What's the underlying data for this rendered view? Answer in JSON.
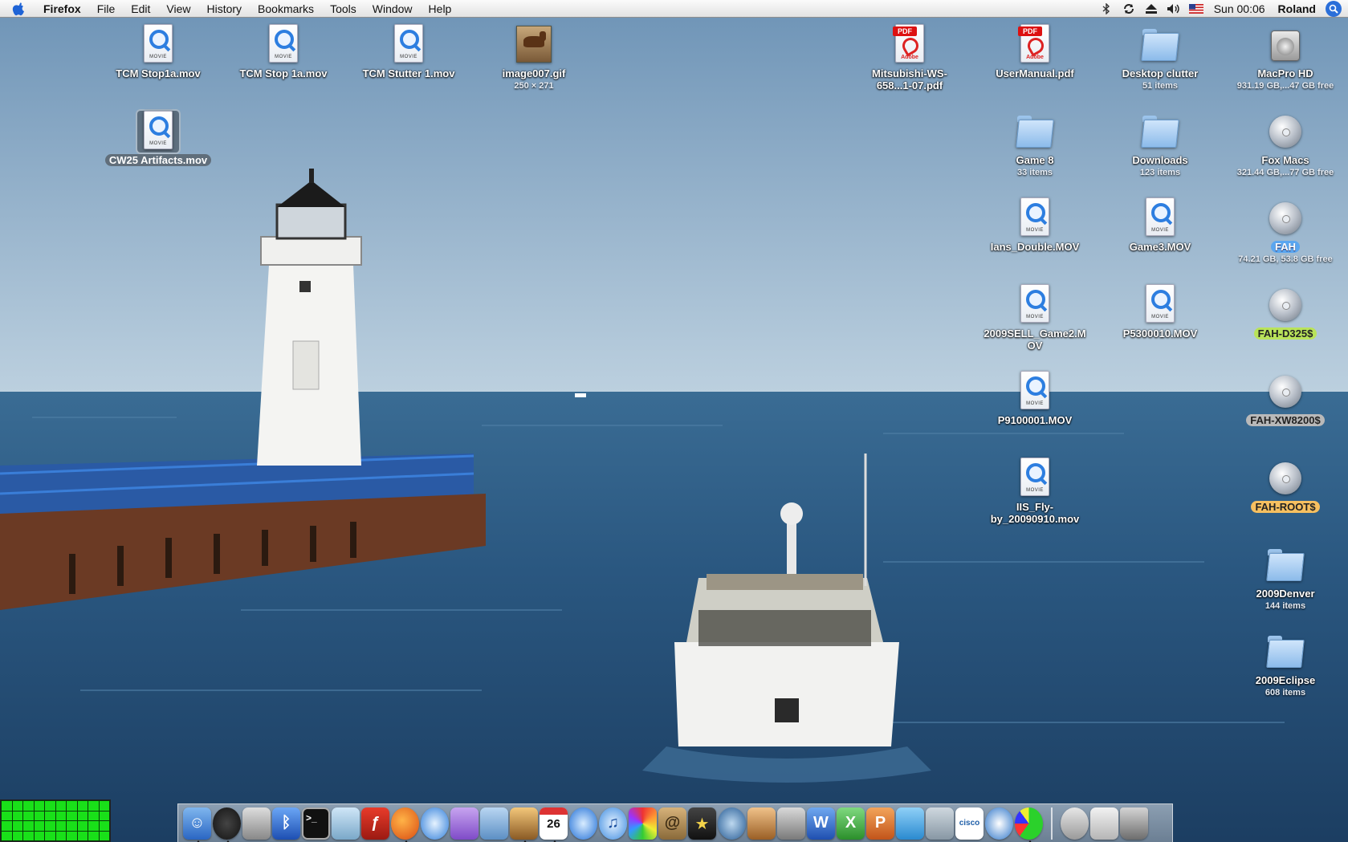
{
  "menubar": {
    "app_name": "Firefox",
    "menus": [
      "File",
      "Edit",
      "View",
      "History",
      "Bookmarks",
      "Tools",
      "Window",
      "Help"
    ],
    "status_icons": [
      "bluetooth-icon",
      "sync-icon",
      "eject-icon",
      "volume-icon",
      "us-flag-icon"
    ],
    "clock": "Sun 00:06",
    "user": "Roland"
  },
  "desktop": {
    "left_icons": [
      {
        "label": "TCM Stop1a.mov",
        "kind": "movie"
      },
      {
        "label": "TCM Stop 1a.mov",
        "kind": "movie"
      },
      {
        "label": "TCM Stutter 1.mov",
        "kind": "movie"
      },
      {
        "label": "image007.gif",
        "sub": "250 × 271",
        "kind": "image"
      },
      {
        "label": "CW25 Artifacts.mov",
        "kind": "movie",
        "selected": true
      }
    ],
    "right_icons": {
      "mitsubishi": {
        "label": "Mitsubishi-WS-658...1-07.pdf"
      },
      "usermanual": {
        "label": "UserManual.pdf"
      },
      "desktop_clutter": {
        "label": "Desktop clutter",
        "sub": "51 items"
      },
      "macpro_hd": {
        "label": "MacPro HD",
        "sub": "931.19 GB,...47 GB free"
      },
      "game8": {
        "label": "Game 8",
        "sub": "33 items"
      },
      "downloads": {
        "label": "Downloads",
        "sub": "123 items"
      },
      "fox_macs": {
        "label": "Fox Macs",
        "sub": "321.44 GB,...77 GB free"
      },
      "ians_double": {
        "label": "Ians_Double.MOV"
      },
      "game3": {
        "label": "Game3.MOV"
      },
      "fah": {
        "label": "FAH",
        "sub": "74.21 GB, 53.8 GB free"
      },
      "game2": {
        "label": "2009SELL_Game2.MOV"
      },
      "p5300010": {
        "label": "P5300010.MOV"
      },
      "fah_d325": {
        "label": "FAH-D325$"
      },
      "p9100001": {
        "label": "P9100001.MOV"
      },
      "fah_xw8200": {
        "label": "FAH-XW8200$"
      },
      "iis_fly": {
        "label": "IIS_Fly-by_20090910.mov"
      },
      "fah_root": {
        "label": "FAH-ROOT$"
      },
      "denver": {
        "label": "2009Denver",
        "sub": "144 items"
      },
      "eclipse": {
        "label": "2009Eclipse",
        "sub": "608 items"
      }
    },
    "movie_tag": "MOVIE",
    "pdf_tag": "PDF",
    "adobe_tag": "Adobe"
  },
  "dock": {
    "calendar_day": "26",
    "items": [
      "finder-icon",
      "dashboard-icon",
      "system-preferences-icon",
      "bluetooth-file-exchange-icon",
      "terminal-icon",
      "box-icon",
      "flash-icon",
      "firefox-icon",
      "safari-icon",
      "mail-client-icon",
      "preview-icon",
      "iphoto-icon",
      "ical-icon",
      "quicktime-icon",
      "itunes-icon",
      "colorful-app-icon",
      "address-book-icon",
      "imovie-icon",
      "dvd-player-icon",
      "garageband-icon",
      "keynote-icon",
      "word-icon",
      "excel-icon",
      "powerpoint-icon",
      "messenger-icon",
      "cisco-icon",
      "cisco-vpn-icon",
      "airport-icon",
      "activity-monitor-icon",
      "mail-stamp-icon",
      "documents-stack-icon",
      "trash-icon"
    ]
  },
  "colors": {
    "sky_top": "#6d93b6",
    "sky_horizon": "#b9cfdf",
    "water": "#27527a",
    "selection": "#3d71d9"
  }
}
